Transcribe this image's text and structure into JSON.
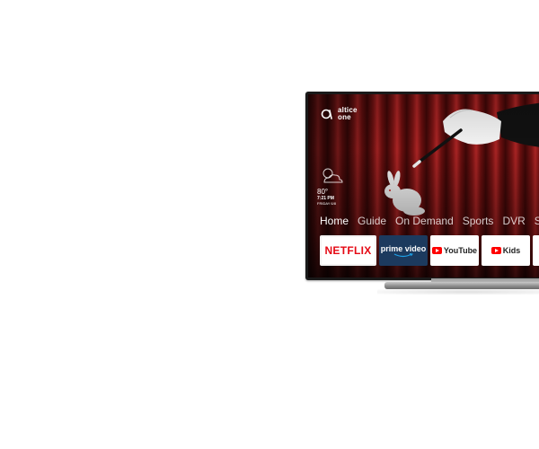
{
  "brand": {
    "line1": "altice",
    "line2": "one",
    "icon": "altice-logo-icon"
  },
  "widget": {
    "icon": "partly-cloudy-icon",
    "temperature": "80°",
    "time": "7:21 PM",
    "date": "FRIDAY 6/8"
  },
  "nav": {
    "items": [
      {
        "label": "Home",
        "active": true
      },
      {
        "label": "Guide",
        "active": false
      },
      {
        "label": "On Demand",
        "active": false
      },
      {
        "label": "Sports",
        "active": false
      },
      {
        "label": "DVR",
        "active": false
      },
      {
        "label": "Se",
        "active": false
      }
    ]
  },
  "apps": {
    "tiles": [
      {
        "label": "NETFLIX",
        "icon": ""
      },
      {
        "label": "prime video",
        "icon": "amazon-smile-icon"
      },
      {
        "label": "YouTube",
        "icon": "youtube-play-icon"
      },
      {
        "label": "Kids",
        "icon": "youtube-play-icon"
      }
    ]
  },
  "colors": {
    "netflix_red": "#e50914",
    "prime_blue": "#1c3a5e",
    "youtube_red": "#ff0000",
    "curtain_red": "#a92424"
  }
}
